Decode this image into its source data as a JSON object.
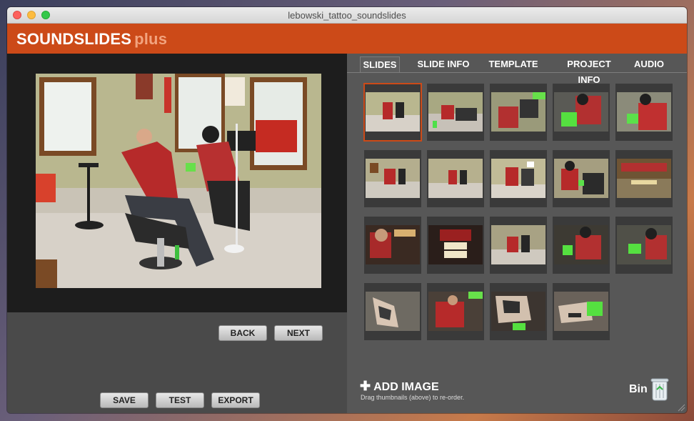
{
  "window": {
    "title": "lebowski_tattoo_soundslides"
  },
  "brand": {
    "name": "SOUNDSLIDES",
    "suffix": "plus"
  },
  "viewer": {
    "image_description": "tattoo-shop-photo",
    "back_label": "BACK",
    "next_label": "NEXT"
  },
  "actions": {
    "save_label": "SAVE",
    "test_label": "TEST",
    "export_label": "EXPORT"
  },
  "tabs": [
    {
      "label": "SLIDES",
      "active": true
    },
    {
      "label": "SLIDE INFO",
      "active": false
    },
    {
      "label": "TEMPLATE",
      "active": false
    },
    {
      "label": "PROJECT INFO",
      "active": false
    },
    {
      "label": "AUDIO",
      "active": false
    }
  ],
  "thumbnails": {
    "count": 19,
    "selected_index": 0
  },
  "add_image": {
    "label": "ADD IMAGE",
    "hint": "Drag thumbnails (above) to re-order."
  },
  "bin": {
    "label": "Bin"
  },
  "colors": {
    "accent": "#cc4a18",
    "brand_suffix": "#f2a37e"
  }
}
